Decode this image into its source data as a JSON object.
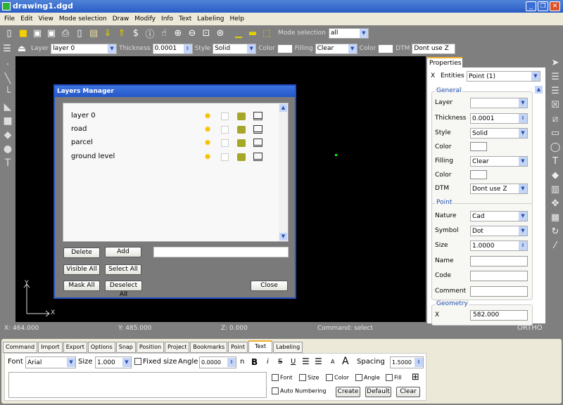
{
  "window": {
    "title": "drawing1.dgd",
    "controls": [
      "_",
      "❐",
      "✕"
    ]
  },
  "menu": [
    "File",
    "Edit",
    "View",
    "Mode selection",
    "Draw",
    "Modify",
    "Info",
    "Text",
    "Labeling",
    "Help"
  ],
  "toolbar1": {
    "icons": [
      "new-icon",
      "open-icon",
      "save-icon",
      "save-as-icon",
      "print-icon",
      "copy-icon",
      "paste-icon",
      "import-icon",
      "export-icon",
      "dollar-icon",
      "info-icon",
      "hand-icon",
      "zoom-in-icon",
      "zoom-out-icon",
      "zoom-window-icon",
      "zoom-extents-icon",
      "measure-point-icon",
      "measure-line-icon",
      "measure-area-icon"
    ],
    "mode_label": "Mode selection",
    "mode_value": "all"
  },
  "toolbar2": {
    "layer_label": "Layer",
    "layer_value": "layer 0",
    "thickness_label": "Thickness",
    "thickness_value": "0.0001",
    "style_label": "Style",
    "style_value": "Solid",
    "color_label": "Color",
    "filling_label": "Filling",
    "filling_value": "Clear",
    "color2_label": "Color",
    "dtm_label": "DTM",
    "dtm_value": "Dont use Z"
  },
  "left_tools": [
    "point-icon",
    "line-icon",
    "polyline-icon",
    "polygon-icon",
    "rectangle-icon",
    "diamond-icon",
    "circle-icon",
    "text-icon"
  ],
  "axes": {
    "x": "X",
    "y": "Y"
  },
  "layers_dialog": {
    "title": "Layers Manager",
    "layers": [
      "layer 0",
      "road",
      "parcel",
      "ground level"
    ],
    "new_layer_value": "",
    "buttons": {
      "delete": "Delete",
      "add": "Add",
      "visible_all": "Visible All",
      "select_all": "Select All",
      "mask_all": "Mask All",
      "deselect_all": "Deselect All",
      "close": "Close"
    }
  },
  "properties": {
    "tab": "Properties",
    "close": "X",
    "entities_label": "Entities",
    "entities_value": "Point (1)",
    "general": {
      "title": "General",
      "layer": {
        "label": "Layer",
        "value": ""
      },
      "thickness": {
        "label": "Thickness",
        "value": "0.0001"
      },
      "style": {
        "label": "Style",
        "value": "Solid"
      },
      "color": {
        "label": "Color"
      },
      "filling": {
        "label": "Filling",
        "value": "Clear"
      },
      "color2": {
        "label": "Color"
      },
      "dtm": {
        "label": "DTM",
        "value": "Dont use Z"
      }
    },
    "point": {
      "title": "Point",
      "nature": {
        "label": "Nature",
        "value": "Cad"
      },
      "symbol": {
        "label": "Symbol",
        "value": "Dot"
      },
      "size": {
        "label": "Size",
        "value": "1.0000"
      },
      "name": {
        "label": "Name",
        "value": ""
      },
      "code": {
        "label": "Code",
        "value": ""
      },
      "comment": {
        "label": "Comment",
        "value": ""
      }
    },
    "geometry": {
      "title": "Geometry",
      "x": {
        "label": "X",
        "value": "582.000"
      }
    }
  },
  "right_tools": [
    "pointer-icon",
    "layers-icon",
    "layers-stack-icon",
    "delete-point-icon",
    "line-tool-icon",
    "page-icon",
    "circle-tool-icon",
    "text-tool-icon",
    "eraser-icon",
    "trash-icon",
    "move-icon",
    "grid-icon",
    "rotate-icon",
    "trim-icon"
  ],
  "status": {
    "x": "X: 464.000",
    "y": "Y: 485.000",
    "z": "Z: 0.000",
    "command": "Command: select",
    "ortho": "ORTHO"
  },
  "bottom": {
    "tabs": [
      "Command",
      "Import",
      "Export",
      "Options",
      "Snap",
      "Position",
      "Project",
      "Bookmarks",
      "Point",
      "Text",
      "Labeling"
    ],
    "active_tab": "Text",
    "text": {
      "font_label": "Font",
      "font_value": "Arial",
      "size_label": "Size",
      "size_value": "1.000",
      "fixed_size": "Fixed size",
      "angle_label": "Angle",
      "angle_value": "0.0000",
      "n": "n",
      "bold": "B",
      "italic": "i",
      "strike": "S",
      "underline": "U",
      "small_a": "A",
      "big_a": "A",
      "spacing_label": "Spacing",
      "spacing_value": "1.5000",
      "chk_font": "Font",
      "chk_size": "Size",
      "chk_color": "Color",
      "chk_angle": "Angle",
      "chk_fill": "Fill",
      "auto_numbering": "Auto Numbering",
      "create": "Create",
      "default": "Default",
      "clear": "Clear",
      "text_value": ""
    }
  }
}
